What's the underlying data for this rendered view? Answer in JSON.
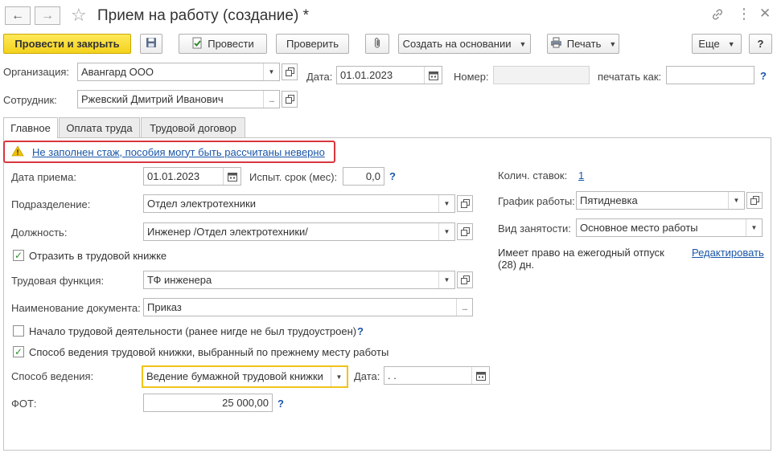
{
  "window": {
    "title": "Прием на работу (создание) *"
  },
  "toolbar": {
    "post_close": "Провести и закрыть",
    "post": "Провести",
    "check": "Проверить",
    "create_based": "Создать на основании",
    "print": "Печать",
    "more": "Еще",
    "help": "?"
  },
  "header": {
    "org_label": "Организация:",
    "org_value": "Авангард ООО",
    "date_label": "Дата:",
    "date_value": "01.01.2023",
    "number_label": "Номер:",
    "number_value": "",
    "print_as_label": "печатать как:",
    "print_as_value": "",
    "help": "?",
    "employee_label": "Сотрудник:",
    "employee_value": "Ржевский Дмитрий Иванович"
  },
  "tabs": [
    {
      "label": "Главное",
      "active": true
    },
    {
      "label": "Оплата труда",
      "active": false
    },
    {
      "label": "Трудовой договор",
      "active": false
    }
  ],
  "warning": {
    "text": "Не заполнен стаж, пособия могут быть рассчитаны неверно"
  },
  "main": {
    "hire_date_label": "Дата приема:",
    "hire_date_value": "01.01.2023",
    "probation_label": "Испыт. срок (мес):",
    "probation_value": "0,0",
    "probation_help": "?",
    "department_label": "Подразделение:",
    "department_value": "Отдел электротехники",
    "position_label": "Должность:",
    "position_value": "Инженер /Отдел электротехники/",
    "reflect_book_label": "Отразить в трудовой книжке",
    "reflect_book_checked": true,
    "labor_function_label": "Трудовая функция:",
    "labor_function_value": "ТФ инженера",
    "doc_name_label": "Наименование документа:",
    "doc_name_value": "Приказ",
    "first_job_label": "Начало трудовой деятельности (ранее нигде не был трудоустроен)",
    "first_job_checked": false,
    "first_job_help": "?",
    "book_method_prev_label": "Способ ведения трудовой книжки, выбранный по прежнему месту работы",
    "book_method_prev_checked": true,
    "method_label": "Способ ведения:",
    "method_value": "Ведение бумажной трудовой книжки",
    "method_date_label": "Дата:",
    "method_date_value": " .  .",
    "fot_label": "ФОТ:",
    "fot_value": "25 000,00",
    "fot_help": "?"
  },
  "right": {
    "rates_label": "Колич. ставок:",
    "rates_value": "1",
    "schedule_label": "График работы:",
    "schedule_value": "Пятидневка",
    "employment_label": "Вид занятости:",
    "employment_value": "Основное место работы",
    "vacation_text_1": "Имеет право на ежегодный отпуск",
    "vacation_text_2": "(28) дн.",
    "edit_link": "Редактировать"
  },
  "colors": {
    "primary_button": "#f3d21c",
    "warning_border": "#d9363e",
    "link": "#1a56a8",
    "focus_border": "#f0c419"
  }
}
